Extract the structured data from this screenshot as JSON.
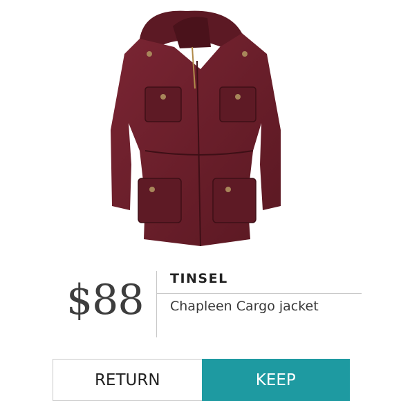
{
  "product": {
    "price": "$88",
    "brand": "TINSEL",
    "name": "Chapleen Cargo jacket",
    "image_icon": "jacket-icon",
    "jacket_color": "#6a1f2b"
  },
  "actions": {
    "return_label": "RETURN",
    "keep_label": "KEEP",
    "keep_color": "#1e9aa1"
  }
}
